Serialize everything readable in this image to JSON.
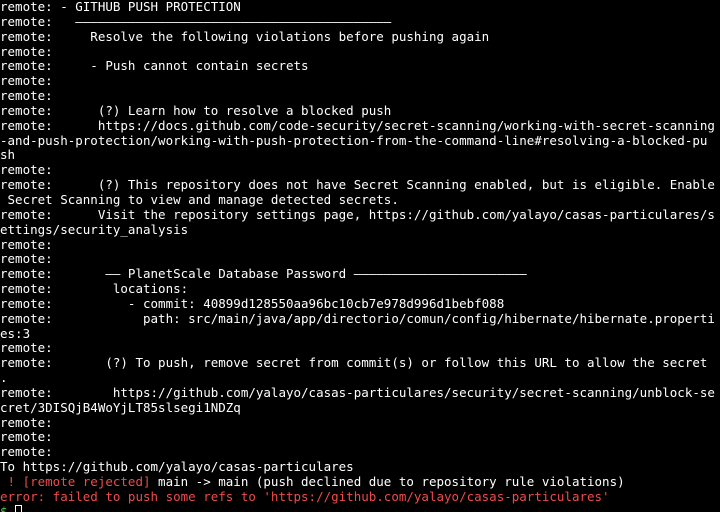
{
  "terminal": {
    "lines": [
      "remote: - GITHUB PUSH PROTECTION",
      "remote:   ——————————————————————————————————————————",
      "remote:     Resolve the following violations before pushing again",
      "remote:",
      "remote:     - Push cannot contain secrets",
      "remote:",
      "remote:",
      "remote:      (?) Learn how to resolve a blocked push",
      "remote:      https://docs.github.com/code-security/secret-scanning/working-with-secret-scanning",
      "-and-push-protection/working-with-push-protection-from-the-command-line#resolving-a-blocked-pu",
      "sh",
      "remote:",
      "remote:      (?) This repository does not have Secret Scanning enabled, but is eligible. Enable",
      " Secret Scanning to view and manage detected secrets.",
      "remote:      Visit the repository settings page, https://github.com/yalayo/casas-particulares/s",
      "ettings/security_analysis",
      "remote:",
      "remote:",
      "remote:       —— PlanetScale Database Password ———————————————————————",
      "remote:        locations:",
      "remote:          - commit: 40899d128550aa96bc10cb7e978d996d1bebf088",
      "remote:            path: src/main/java/app/directorio/comun/config/hibernate/hibernate.properti",
      "es:3",
      "remote:",
      "remote:       (?) To push, remove secret from commit(s) or follow this URL to allow the secret",
      ".",
      "remote:        https://github.com/yalayo/casas-particulares/security/secret-scanning/unblock-se",
      "cret/3DISQjB4WoYjLT85slsegi1NDZq",
      "remote:",
      "remote:",
      "remote:",
      "To https://github.com/yalayo/casas-particulares"
    ],
    "rejected_line": " ! [remote rejected] main -> main (push declined due to repository rule violations)",
    "rejected_marker": " ! [remote rejected]",
    "rejected_rest": " main -> main (push declined due to repository rule violations)",
    "error_line": "error: failed to push some refs to 'https://github.com/yalayo/casas-particulares'",
    "prompt_tail": "$ "
  },
  "colors": {
    "background": "#000000",
    "text": "#ffffff",
    "error": "#ee4b4b"
  }
}
